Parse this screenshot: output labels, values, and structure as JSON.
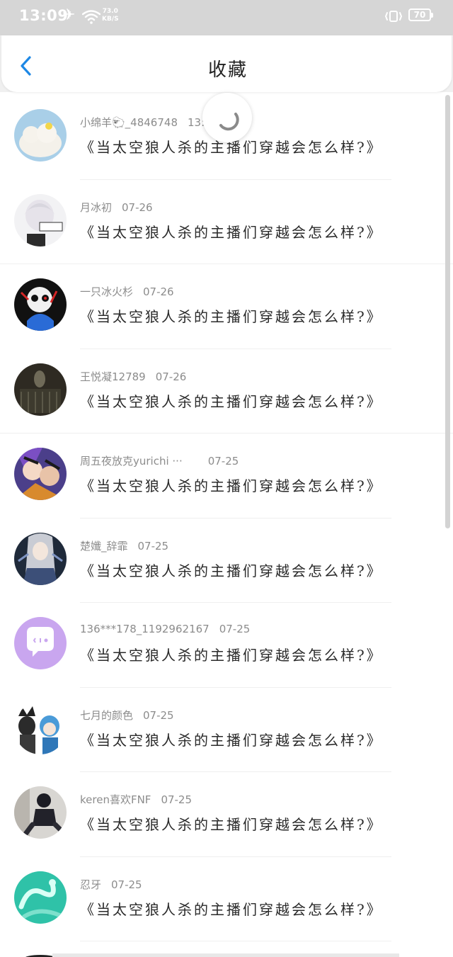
{
  "status_bar": {
    "time": "13:09",
    "speed_value": "73.0",
    "speed_unit": "KB/S",
    "battery": "70"
  },
  "header": {
    "title": "收藏"
  },
  "items": [
    {
      "author": "小绵羊🐑_4846748",
      "date": "13:12",
      "title": "《当太空狼人杀的主播们穿越会怎么样?》"
    },
    {
      "author": "月冰初",
      "date": "07-26",
      "title": "《当太空狼人杀的主播们穿越会怎么样?》"
    },
    {
      "author": "一只冰火杉",
      "date": "07-26",
      "title": "《当太空狼人杀的主播们穿越会怎么样?》"
    },
    {
      "author": "王悦凝12789",
      "date": "07-26",
      "title": "《当太空狼人杀的主播们穿越会怎么样?》"
    },
    {
      "author": "周五夜放克yurichi ···",
      "date": "07-25",
      "title": "《当太空狼人杀的主播们穿越会怎么样?》"
    },
    {
      "author": "楚孅_辞霏",
      "date": "07-25",
      "title": "《当太空狼人杀的主播们穿越会怎么样?》"
    },
    {
      "author": "136***178_1192962167",
      "date": "07-25",
      "title": "《当太空狼人杀的主播们穿越会怎么样?》"
    },
    {
      "author": "七月的颜色",
      "date": "07-25",
      "title": "《当太空狼人杀的主播们穿越会怎么样?》"
    },
    {
      "author": "keren喜欢FNF",
      "date": "07-25",
      "title": "《当太空狼人杀的主播们穿越会怎么样?》"
    },
    {
      "author": "忍牙",
      "date": "07-25",
      "title": "《当太空狼人杀的主播们穿越会怎么样?》"
    }
  ],
  "colors": {
    "accent": "#1e88e5",
    "meta_text": "#8c8c8c",
    "title_text": "#2a2a2a",
    "status_bar_bg": "#d6d6d6"
  }
}
